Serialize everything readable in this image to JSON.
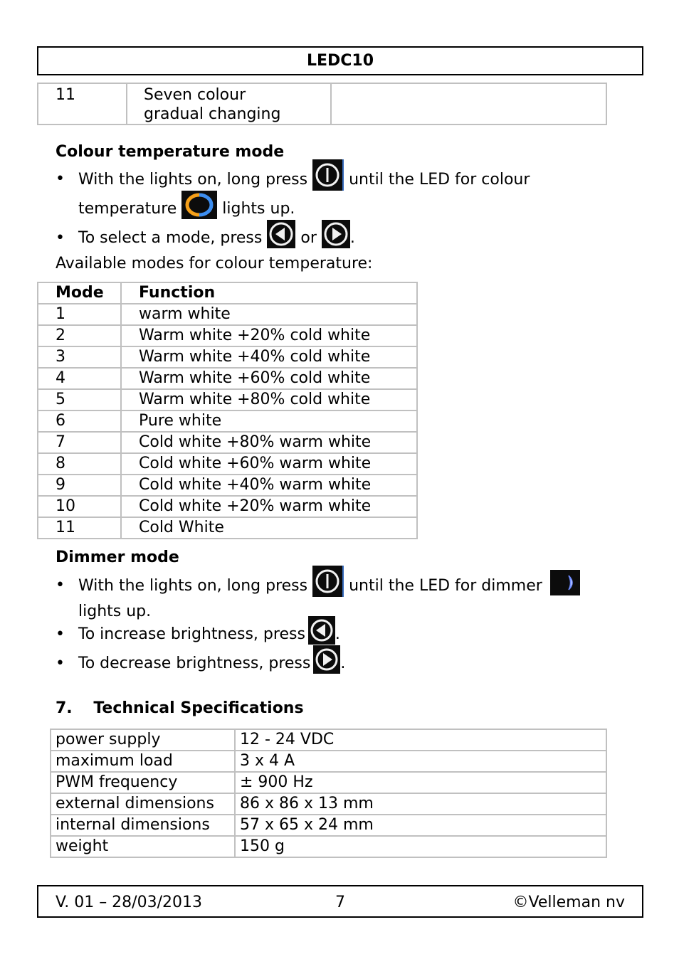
{
  "header": {
    "title": "LEDC10"
  },
  "continuation_table": {
    "row": {
      "mode": "11",
      "function_line1": "Seven colour",
      "function_line2": "gradual changing",
      "extra": ""
    }
  },
  "colour_temperature": {
    "heading": "Colour temperature mode",
    "bullet1_part1": "With the lights on, long press",
    "bullet1_part2": "until the LED for colour",
    "bullet1_part3": "temperature",
    "bullet1_part4": "lights up.",
    "bullet2_part1": "To select a mode, press",
    "bullet2_part2": "or",
    "bullet2_part3": ".",
    "intro": "Available modes for colour temperature:",
    "table": {
      "headers": [
        "Mode",
        "Function"
      ],
      "rows": [
        [
          "1",
          "warm white"
        ],
        [
          "2",
          "Warm white +20% cold white"
        ],
        [
          "3",
          "Warm white +40% cold white"
        ],
        [
          "4",
          "Warm white +60% cold white"
        ],
        [
          "5",
          "Warm white +80% cold white"
        ],
        [
          "6",
          "Pure white"
        ],
        [
          "7",
          "Cold white +80% warm white"
        ],
        [
          "8",
          "Cold white +60% warm white"
        ],
        [
          "9",
          "Cold white +40% warm white"
        ],
        [
          "10",
          "Cold white +20% warm white"
        ],
        [
          "11",
          "Cold White"
        ]
      ]
    }
  },
  "dimmer": {
    "heading": "Dimmer mode",
    "bullet1_part1": "With the lights on, long press",
    "bullet1_part2": "until the LED for dimmer",
    "bullet1_part3": "lights up.",
    "bullet2_part1": "To increase brightness, press",
    "bullet2_part2": ".",
    "bullet3_part1": "To decrease brightness, press",
    "bullet3_part2": "."
  },
  "specs": {
    "heading_number": "7.",
    "heading_text": "Technical Specifications",
    "rows": [
      [
        "power supply",
        "12 - 24 VDC"
      ],
      [
        "maximum load",
        "3 x 4 A"
      ],
      [
        "PWM frequency",
        "± 900 Hz"
      ],
      [
        "external dimensions",
        "86 x 86 x 13 mm"
      ],
      [
        "internal dimensions",
        "57 x 65 x 24 mm"
      ],
      [
        "weight",
        "150 g"
      ]
    ]
  },
  "footer": {
    "version": "V. 01 – 28/03/2013",
    "page": "7",
    "copyright": "©Velleman nv"
  },
  "icons": {
    "power": "power-button-icon",
    "colour_temp": "colour-temperature-led-icon",
    "left": "left-arrow-button-icon",
    "right": "right-arrow-button-icon",
    "dimmer": "dimmer-led-icon"
  },
  "colors": {
    "table_border": "#c0c0c0",
    "icon_bg": "#0c0c0c",
    "warm_orange": "#f5a01a",
    "cold_blue": "#3d8ef0",
    "dimmer_blue": "#8ea8ff"
  }
}
